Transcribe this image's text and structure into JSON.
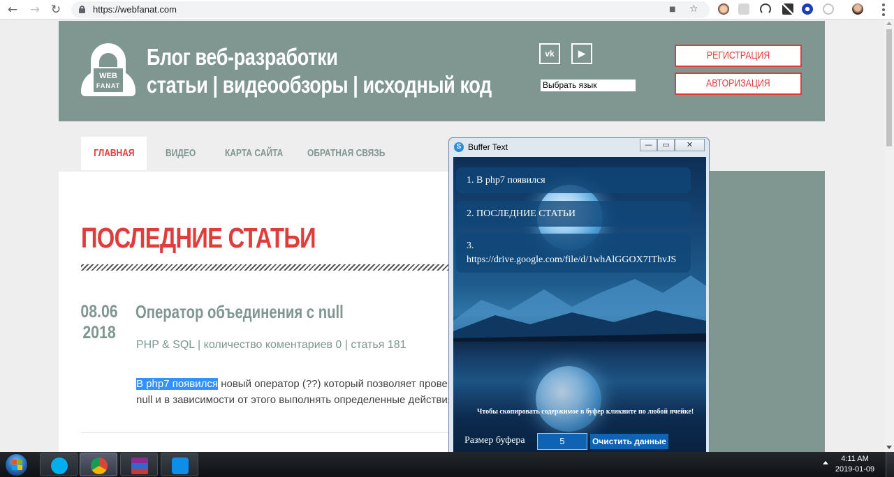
{
  "browser": {
    "url": "https://webfanat.com",
    "back_glyph": "←",
    "forward_glyph": "→",
    "reload_glyph": "↻",
    "star_glyph": "☆",
    "camera_glyph": "■"
  },
  "site": {
    "logo_line1": "WEB",
    "logo_line2": "FANAT",
    "title_line1": "Блог веб-разработки",
    "title_line2": "статьи | видеообзоры | исходный код",
    "social_vk": "vk",
    "social_youtube": "▶",
    "language_select": "Выбрать язык",
    "register_label": "РЕГИСТРАЦИЯ",
    "login_label": "АВТОРИЗАЦИЯ",
    "brand_color": "#7f9691",
    "accent_color": "#e03c3c"
  },
  "menu": {
    "items": [
      "ГЛАВНАЯ",
      "ВИДЕО",
      "КАРТА САЙТА",
      "ОБРАТНАЯ СВЯЗЬ"
    ]
  },
  "content": {
    "section_title": "ПОСЛЕДНИЕ СТАТЬИ",
    "post": {
      "date_day": "08.06",
      "date_year": "2018",
      "title": "Оператор объединения с null",
      "meta": "PHP & SQL | количество коментариев 0 | статья 181",
      "excerpt_highlight": "В php7 появился",
      "excerpt_line1_rest": " новый оператор (??) который позволяет провер",
      "excerpt_line2": "null и в зависимости от этого выполнять определенные действия"
    }
  },
  "window": {
    "title": "Buffer Text",
    "min_glyph": "—",
    "max_glyph": "▭",
    "close_glyph": "✕",
    "cells": [
      {
        "number": "1.",
        "text": "В php7 появился"
      },
      {
        "number": "2.",
        "text": "ПОСЛЕДНИЕ СТАТЬИ"
      },
      {
        "number": "3.",
        "text": "https://drive.google.com/file/d/1whAlGGOX7IThvJS"
      }
    ],
    "hint": "Чтобы скопировать содержимое в буфер кликните по любой ячейке!",
    "buffer_size_label": "Размер буфера",
    "buffer_size_value": "5",
    "clear_label": "Очистить данные"
  },
  "taskbar": {
    "apps": [
      "skype",
      "chrome",
      "winrar",
      "teamviewer"
    ],
    "time": "4:11 AM",
    "date": "2019-01-09"
  }
}
